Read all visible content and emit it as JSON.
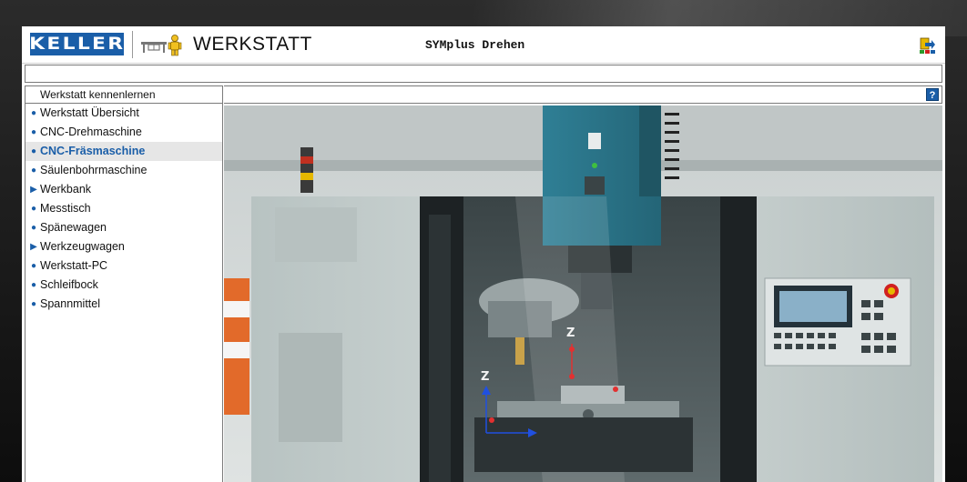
{
  "header": {
    "logo_text": "KELLER",
    "app_title": "WERKSTATT",
    "subtitle": "SYMplus Drehen",
    "icons": [
      "workbench-icon",
      "worker-icon",
      "exit-icon"
    ]
  },
  "sidebar": {
    "heading": "Werkstatt kennenlernen",
    "items": [
      {
        "label": "Werkstatt Übersicht",
        "marker": "bullet",
        "active": false
      },
      {
        "label": "CNC-Drehmaschine",
        "marker": "bullet",
        "active": false
      },
      {
        "label": "CNC-Fräsmaschine",
        "marker": "bullet",
        "active": true
      },
      {
        "label": "Säulenbohrmaschine",
        "marker": "bullet",
        "active": false
      },
      {
        "label": "Werkbank",
        "marker": "arrow",
        "active": false
      },
      {
        "label": "Messtisch",
        "marker": "bullet",
        "active": false
      },
      {
        "label": "Spänewagen",
        "marker": "bullet",
        "active": false
      },
      {
        "label": "Werkzeugwagen",
        "marker": "arrow",
        "active": false
      },
      {
        "label": "Werkstatt-PC",
        "marker": "bullet",
        "active": false
      },
      {
        "label": "Schleifbock",
        "marker": "bullet",
        "active": false
      },
      {
        "label": "Spannmittel",
        "marker": "bullet",
        "active": false
      }
    ]
  },
  "content": {
    "help_label": "?",
    "axis_labels": {
      "z_spindle": "Z",
      "z_table": "Z"
    }
  },
  "colors": {
    "brand_blue": "#1a5ea8",
    "machine_teal": "#2f7f95",
    "active_text": "#1a5ea8"
  }
}
